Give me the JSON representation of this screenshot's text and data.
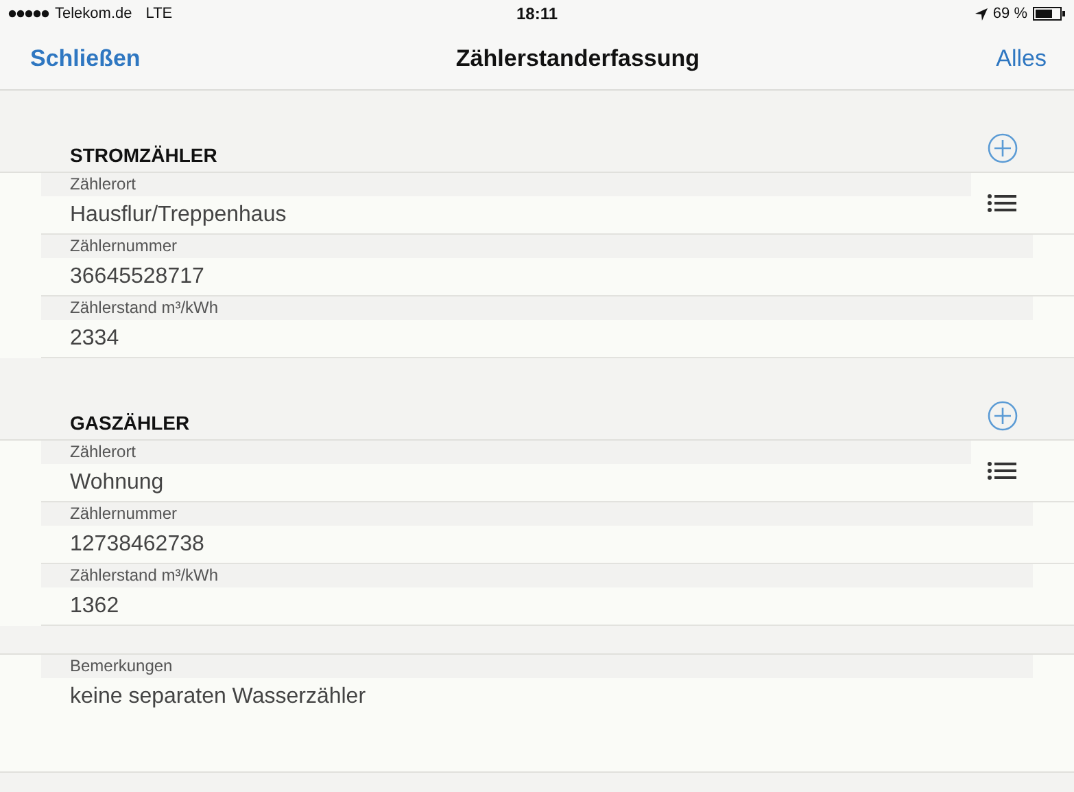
{
  "status_bar": {
    "carrier": "Telekom.de",
    "network": "LTE",
    "time": "18:11",
    "battery": "69 %"
  },
  "nav": {
    "left": "Schließen",
    "title": "Zählerstanderfassung",
    "right": "Alles"
  },
  "sections": [
    {
      "title": "STROMZÄHLER",
      "fields": [
        {
          "kind": "picker",
          "label": "Zählerort",
          "value": "Hausflur/Treppenhaus"
        },
        {
          "kind": "text",
          "label": "Zählernummer",
          "value": "36645528717"
        },
        {
          "kind": "text",
          "label": "Zählerstand m³/kWh",
          "value": "2334"
        }
      ]
    },
    {
      "title": "GASZÄHLER",
      "fields": [
        {
          "kind": "picker",
          "label": "Zählerort",
          "value": "Wohnung"
        },
        {
          "kind": "text",
          "label": "Zählernummer",
          "value": "12738462738"
        },
        {
          "kind": "text",
          "label": "Zählerstand m³/kWh",
          "value": "1362"
        }
      ]
    }
  ],
  "remarks": {
    "label": "Bemerkungen",
    "value": "keine separaten Wasserzähler"
  }
}
